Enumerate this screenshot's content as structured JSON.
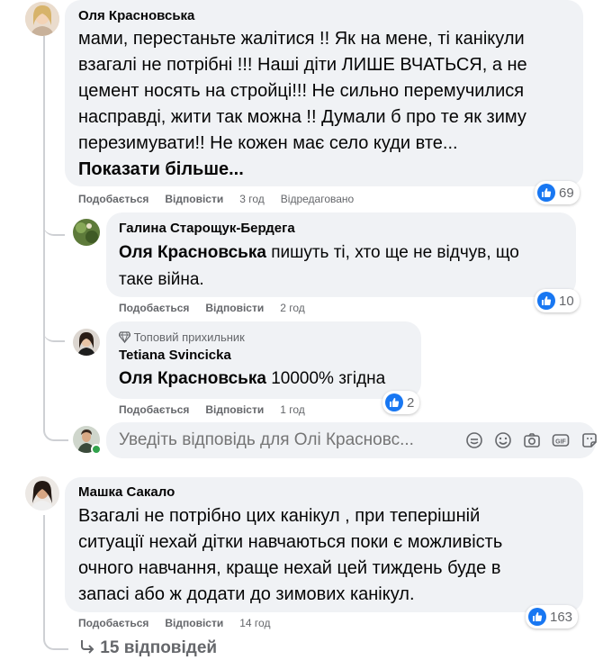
{
  "comments": [
    {
      "author": "Оля Красновська",
      "lines": [
        "мами, перестаньте жалітися !! Як на мене, ті канікули",
        "взагалі не потрібні !!! Наші діти ЛИШЕ ВЧАТЬСЯ, а не",
        "цемент носять на стройці!!! Не сильно перемучилися",
        "насправді, жити так можна !! Думали б про те як зиму",
        "перезимувати!! Не кожен має село куди вте..."
      ],
      "see_more": "Показати більше...",
      "like": "Подобається",
      "reply": "Відповісти",
      "time": "3 год",
      "edited": "Відредаговано",
      "reactions": "69"
    },
    {
      "author": "Машка Сакало",
      "lines": [
        "Взагалі не потрібно цих канікул , при теперішній",
        "ситуації нехай дітки навчаються поки є можливість",
        "очного навчання, краще нехай цей тиждень буде в",
        "запасі або ж додати до зимових канікул."
      ],
      "like": "Подобається",
      "reply": "Відповісти",
      "time": "14 год",
      "reactions": "163"
    }
  ],
  "replies": [
    {
      "author": "Галина Старощук-Бердега",
      "mention": "Оля Красновська",
      "lines": [
        " пишуть ті, хто ще не відчув, що",
        "таке війна."
      ],
      "like": "Подобається",
      "reply": "Відповісти",
      "time": "2 год",
      "reactions": "10"
    },
    {
      "badge": "Топовий прихильник",
      "author": "Tetiana Svincicka",
      "mention": "Оля Красновська",
      "text": " 10000% згідна",
      "like": "Подобається",
      "reply": "Відповісти",
      "time": "1 год",
      "reactions": "2"
    }
  ],
  "reply_input": {
    "placeholder": "Уведіть відповідь для Олі Красновс..."
  },
  "view_replies": "15 відповідей",
  "icons": [
    "like-icon",
    "diamond-icon",
    "sticker-icon",
    "emoji-icon",
    "camera-icon",
    "gif-icon",
    "avatar-sticker-icon",
    "reply-arrow-icon"
  ],
  "colors": {
    "bubble": "#f0f2f5",
    "like_blue": "#1877f2",
    "meta": "#65676b"
  }
}
